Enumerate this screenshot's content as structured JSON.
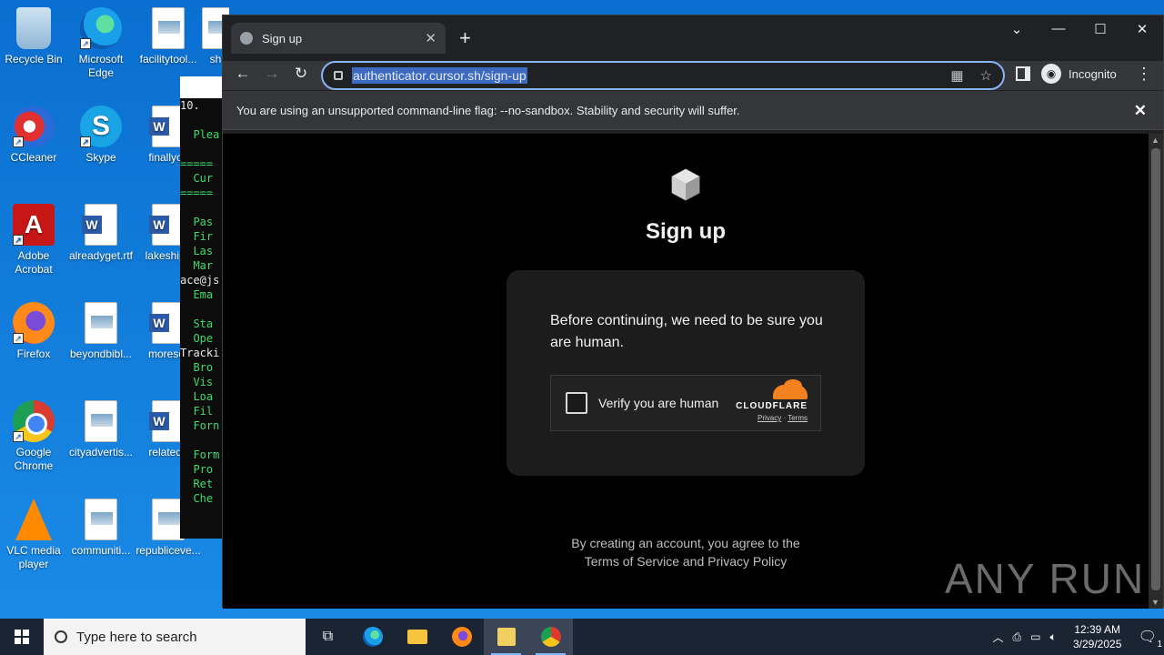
{
  "desktop": {
    "icons": [
      {
        "label": "Recycle Bin"
      },
      {
        "label": "Microsoft Edge"
      },
      {
        "label": "facilitytool..."
      },
      {
        "label": "sh"
      },
      {
        "label": "CCleaner"
      },
      {
        "label": "Skype"
      },
      {
        "label": "finallych"
      },
      {
        "label": "Adobe Acrobat"
      },
      {
        "label": "alreadyget.rtf"
      },
      {
        "label": "lakeshipp"
      },
      {
        "label": "Firefox"
      },
      {
        "label": "beyondbibl..."
      },
      {
        "label": "moresor"
      },
      {
        "label": "Google Chrome"
      },
      {
        "label": "cityadvertis..."
      },
      {
        "label": "relatedp"
      },
      {
        "label": "VLC media player"
      },
      {
        "label": "communiti..."
      },
      {
        "label": "republiceve..."
      }
    ]
  },
  "console": {
    "title": "C:\\",
    "lines": [
      "10. ",
      "",
      "  Plea",
      "",
      "=====",
      "  Cur",
      "=====",
      "",
      "  Pas",
      "  Fir",
      "  Las",
      "  Mar",
      "ace@js",
      "  Ema",
      "",
      "  Sta",
      "  Ope",
      "Tracki",
      "  Bro",
      "  Vis",
      "  Loa",
      "  Fil",
      "  Forn",
      "",
      "  Form",
      "  Pro",
      "  Ret",
      "  Che"
    ]
  },
  "browser": {
    "tab_title": "Sign up",
    "url": "authenticator.cursor.sh/sign-up",
    "incognito_label": "Incognito",
    "infobar_message": "You are using an unsupported command-line flag: --no-sandbox. Stability and security will suffer."
  },
  "page": {
    "heading": "Sign up",
    "prompt": "Before continuing, we need to be sure you are human.",
    "verify_label": "Verify you are human",
    "cloudflare_brand": "CLOUDFLARE",
    "privacy_link": "Privacy",
    "link_separator": "·",
    "terms_link": "Terms",
    "terms_line1": "By creating an account, you agree to the",
    "terms_line2": "Terms of Service and Privacy Policy",
    "watermark": "ANY RUN"
  },
  "taskbar": {
    "search_placeholder": "Type here to search",
    "time": "12:39 AM",
    "date": "3/29/2025",
    "notification_count": "1"
  },
  "colors": {
    "desktop_bg": "#0a78d7",
    "focus_ring": "#8ab4f8",
    "cloudflare_orange": "#f48120"
  }
}
